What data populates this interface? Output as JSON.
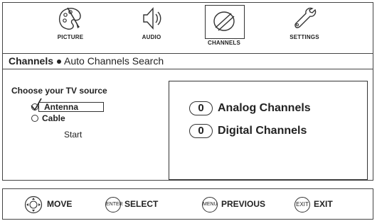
{
  "tabs": [
    {
      "label": "PICTURE",
      "icon": "picture-palette-icon",
      "selected": false
    },
    {
      "label": "AUDIO",
      "icon": "audio-speaker-icon",
      "selected": false
    },
    {
      "label": "CHANNELS",
      "icon": "channels-satellite-icon",
      "selected": true
    },
    {
      "label": "SETTINGS",
      "icon": "settings-wrench-icon",
      "selected": false
    }
  ],
  "breadcrumb": {
    "section": "Channels",
    "page": "Auto Channels Search"
  },
  "source": {
    "title": "Choose your TV source",
    "options": [
      {
        "label": "Antenna",
        "selected": true
      },
      {
        "label": "Cable",
        "selected": false
      }
    ],
    "start_label": "Start"
  },
  "results": {
    "analog_count": "0",
    "analog_label": "Analog Channels",
    "digital_count": "0",
    "digital_label": "Digital Channels"
  },
  "footer": {
    "move_label": "MOVE",
    "enter_icon": "ENTER",
    "select_label": "SELECT",
    "menu_icon": "MENU",
    "previous_label": "PREVIOUS",
    "exit_icon": "EXIT",
    "exit_label": "EXIT"
  }
}
